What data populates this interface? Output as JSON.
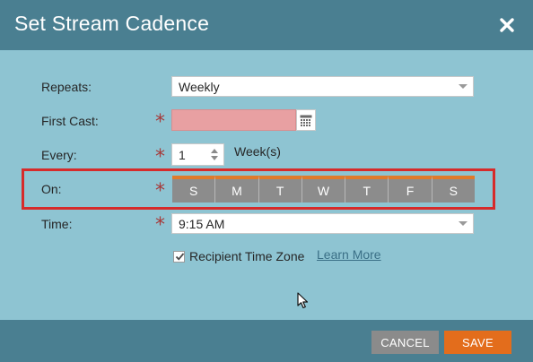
{
  "dialog": {
    "title": "Set Stream Cadence"
  },
  "form": {
    "repeats": {
      "label": "Repeats:",
      "value": "Weekly"
    },
    "first_cast": {
      "label": "First Cast:",
      "value": ""
    },
    "every": {
      "label": "Every:",
      "value": "1",
      "unit": "Week(s)"
    },
    "on": {
      "label": "On:",
      "days": [
        "S",
        "M",
        "T",
        "W",
        "T",
        "F",
        "S"
      ]
    },
    "time": {
      "label": "Time:",
      "value": "9:15 AM"
    },
    "recipient_tz": {
      "label": "Recipient Time Zone",
      "checked": true
    },
    "learn_more": "Learn More",
    "required_marker": "*"
  },
  "footer": {
    "cancel_label": "CANCEL",
    "save_label": "SAVE"
  },
  "colors": {
    "header": "#4a7f91",
    "body": "#8ec4d2",
    "accent": "#e36d1c",
    "required": "#a63a3a",
    "invalid_field": "#e8a0a2",
    "highlight": "#d62b2b"
  },
  "icons": [
    "close-icon",
    "calendar-icon",
    "checkmark-icon",
    "mouse-pointer-icon"
  ]
}
